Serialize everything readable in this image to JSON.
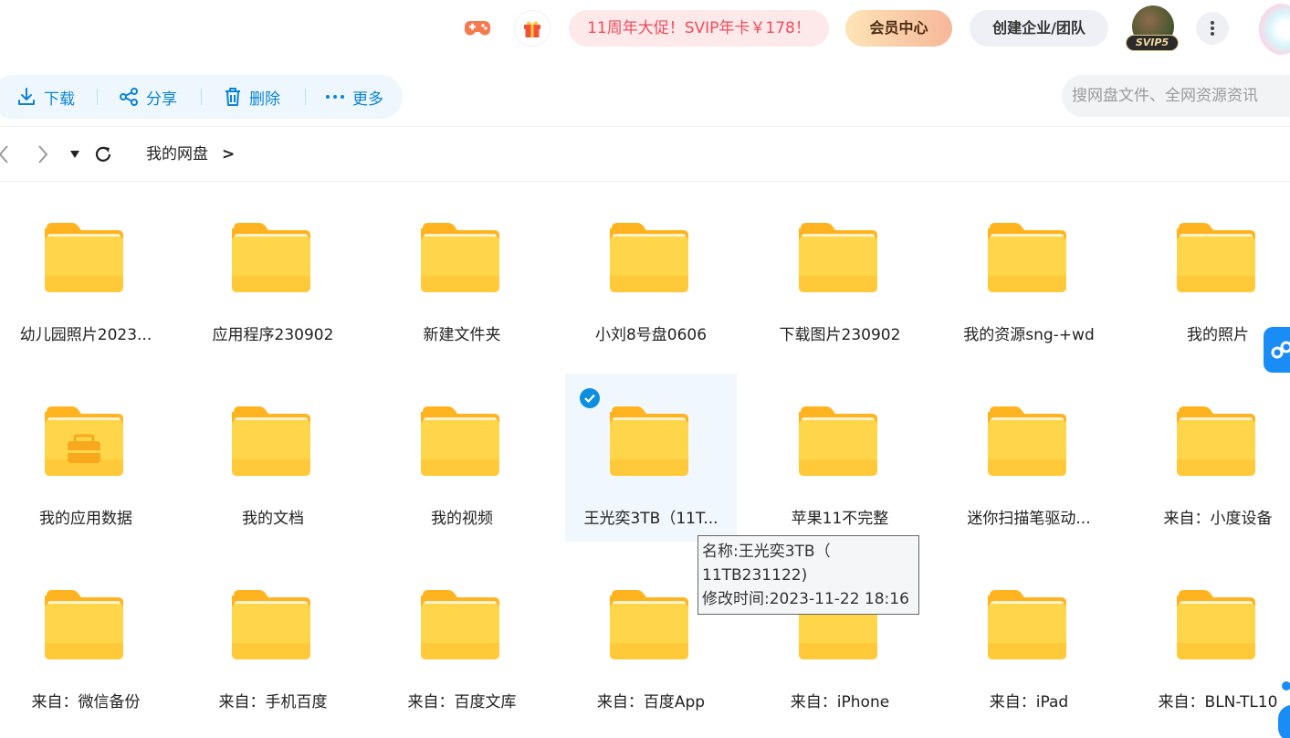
{
  "topbar": {
    "game_icon": "gamepad-icon",
    "gift_icon": "gift-icon",
    "promo_text": "11周年大促！SVIP年卡￥178！",
    "vip_center_label": "会员中心",
    "create_team_label": "创建企业/团队",
    "svip_badge": "SVIP5",
    "more_icon": "vertical-dots-icon"
  },
  "toolbar": {
    "download_label": "下载",
    "share_label": "分享",
    "delete_label": "删除",
    "more_label": "更多"
  },
  "search": {
    "placeholder": "搜网盘文件、全网资源资讯"
  },
  "nav": {
    "breadcrumb_root": "我的网盘",
    "breadcrumb_separator": ">"
  },
  "files": [
    {
      "name": "幼儿园照片2023...",
      "type": "folder"
    },
    {
      "name": "应用程序230902",
      "type": "folder"
    },
    {
      "name": "新建文件夹",
      "type": "folder"
    },
    {
      "name": "小刘8号盘0606",
      "type": "folder"
    },
    {
      "name": "下载图片230902",
      "type": "folder"
    },
    {
      "name": "我的资源sng-+wd",
      "type": "folder"
    },
    {
      "name": "我的照片",
      "type": "folder"
    },
    {
      "name": "我的应用数据",
      "type": "app-folder"
    },
    {
      "name": "我的文档",
      "type": "folder"
    },
    {
      "name": "我的视频",
      "type": "folder"
    },
    {
      "name": "王光奕3TB（11T...",
      "type": "folder",
      "selected": true
    },
    {
      "name": "苹果11不完整",
      "type": "folder"
    },
    {
      "name": "迷你扫描笔驱动...",
      "type": "folder"
    },
    {
      "name": "来自：小度设备",
      "type": "folder"
    },
    {
      "name": "来自：微信备份",
      "type": "folder"
    },
    {
      "name": "来自：手机百度",
      "type": "folder"
    },
    {
      "name": "来自：百度文库",
      "type": "folder"
    },
    {
      "name": "来自：百度App",
      "type": "folder"
    },
    {
      "name": "来自：iPhone",
      "type": "folder"
    },
    {
      "name": "来自：iPad",
      "type": "folder"
    },
    {
      "name": "来自：BLN-TL10",
      "type": "folder"
    }
  ],
  "tooltip": {
    "line1": "名称:王光奕3TB（",
    "line2": "11TB231122)",
    "line3": "修改时间:2023-11-22 18:16"
  },
  "colors": {
    "accent": "#0b83d4",
    "folder_yellow": "#ffd54a",
    "folder_tab": "#ffb31f",
    "promo_red": "#ef4d5b"
  }
}
